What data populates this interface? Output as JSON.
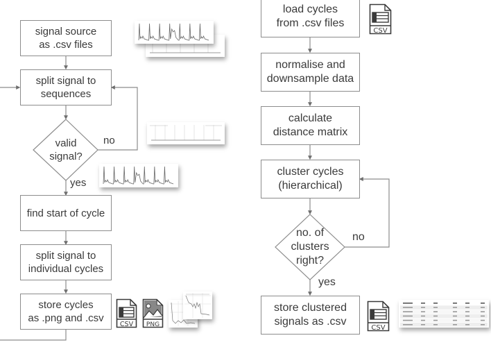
{
  "left_flow": {
    "steps": [
      {
        "id": "signal-source",
        "label": "signal source\nas .csv files"
      },
      {
        "id": "split-sequences",
        "label": "split signal to\nsequences"
      },
      {
        "id": "valid-signal",
        "label": "valid\nsignal?",
        "type": "decision"
      },
      {
        "id": "find-start",
        "label": "find start of cycle"
      },
      {
        "id": "split-cycles",
        "label": "split signal to\nindividual cycles"
      },
      {
        "id": "store-cycles",
        "label": "store cycles\nas .png and .csv"
      }
    ],
    "edge_labels": {
      "no": "no",
      "yes": "yes"
    }
  },
  "right_flow": {
    "steps": [
      {
        "id": "load-cycles",
        "label": "load cycles\nfrom .csv files"
      },
      {
        "id": "normalise",
        "label": "normalise and\ndownsample data"
      },
      {
        "id": "distance-matrix",
        "label": "calculate\ndistance matrix"
      },
      {
        "id": "cluster-cycles",
        "label": "cluster cycles\n(hierarchical)"
      },
      {
        "id": "clusters-right",
        "label": "no. of\nclusters\nright?",
        "type": "decision"
      },
      {
        "id": "store-clustered",
        "label": "store clustered\nsignals as .csv"
      }
    ],
    "edge_labels": {
      "no": "no",
      "yes": "yes"
    }
  },
  "icons": {
    "csv_label": "CSV",
    "png_label": "PNG"
  },
  "colors": {
    "line": "#8c8c8c",
    "icon": "#3a3a3a",
    "signal": "#666666"
  }
}
